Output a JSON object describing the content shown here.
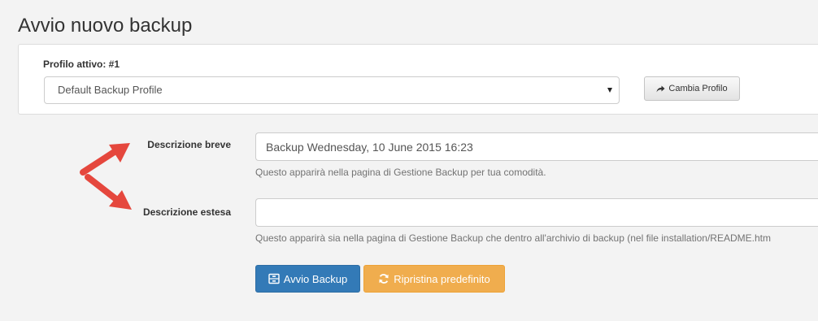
{
  "page": {
    "title": "Avvio nuovo backup"
  },
  "profile": {
    "label": "Profilo attivo: #1",
    "selected": "Default Backup Profile",
    "change_button": "Cambia Profilo"
  },
  "form": {
    "short_description": {
      "label": "Descrizione breve",
      "value": "Backup Wednesday, 10 June 2015 16:23",
      "help": "Questo apparirà nella pagina di Gestione Backup per tua comodità."
    },
    "long_description": {
      "label": "Descrizione estesa",
      "value": "",
      "help": "Questo apparirà sia nella pagina di Gestione Backup che dentro all'archivio di backup (nel file installation/README.htm"
    }
  },
  "actions": {
    "start_backup": "Avvio Backup",
    "reset_defaults": "Ripristina predefinito"
  },
  "colors": {
    "background": "#f3f3f3",
    "primary": "#337ab7",
    "warning": "#f0ad4e",
    "annotation_arrow": "#e5473d"
  },
  "icons": {
    "change_profile": "share-icon",
    "start_backup": "archive-icon",
    "reset_defaults": "refresh-icon",
    "select": "caret-down-icon"
  }
}
